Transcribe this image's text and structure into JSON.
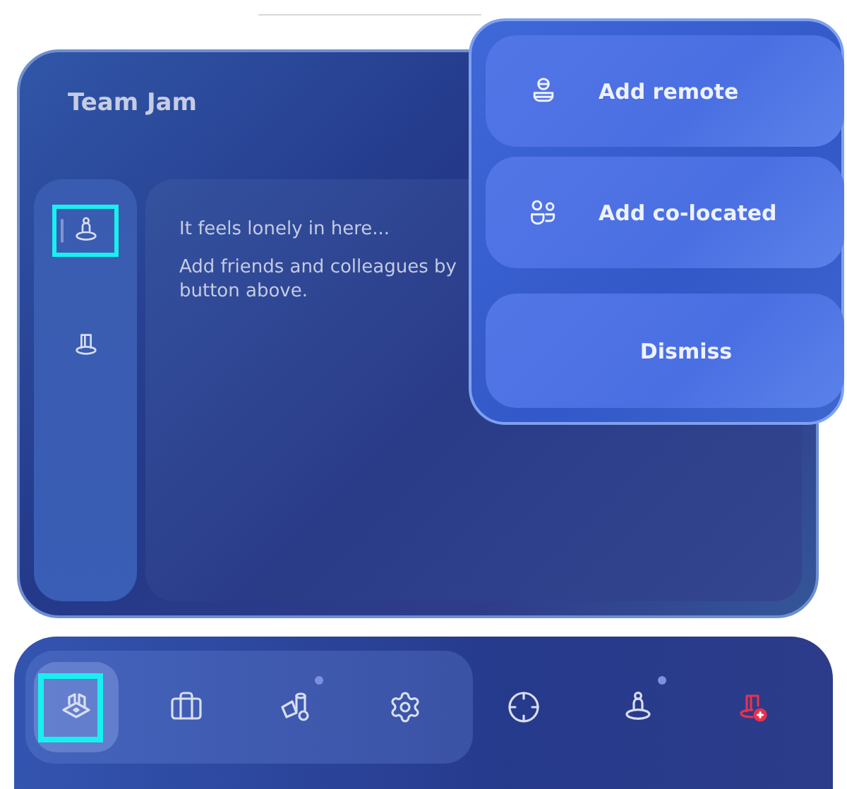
{
  "panel": {
    "title": "Team Jam",
    "sidebar": [
      {
        "kind": "person-stand",
        "selected": true,
        "highlighted": true
      },
      {
        "kind": "door-stand",
        "selected": false,
        "highlighted": false
      }
    ],
    "empty_state": {
      "heading": "It feels lonely in here...",
      "lines": [
        "Add friends and colleagues by",
        "button above."
      ]
    }
  },
  "popup": {
    "buttons": [
      {
        "kind": "remote",
        "label": "Add remote"
      },
      {
        "kind": "co-located",
        "label": "Add co-located"
      },
      {
        "kind": "plain",
        "label": "Dismiss"
      }
    ]
  },
  "dock": {
    "primary": [
      {
        "kind": "floor-plan",
        "selected": true,
        "highlighted": true,
        "dot": false,
        "alert": false
      },
      {
        "kind": "toolbox",
        "selected": false,
        "highlighted": false,
        "dot": false,
        "alert": false
      },
      {
        "kind": "shapes",
        "selected": false,
        "highlighted": false,
        "dot": true,
        "alert": false
      },
      {
        "kind": "gear",
        "selected": false,
        "highlighted": false,
        "dot": false,
        "alert": false
      }
    ],
    "secondary": [
      {
        "kind": "target",
        "selected": false,
        "highlighted": false,
        "dot": false,
        "alert": false
      },
      {
        "kind": "person-stand",
        "selected": false,
        "highlighted": false,
        "dot": true,
        "alert": false
      },
      {
        "kind": "door-add",
        "selected": false,
        "highlighted": false,
        "dot": false,
        "alert": true
      }
    ]
  }
}
